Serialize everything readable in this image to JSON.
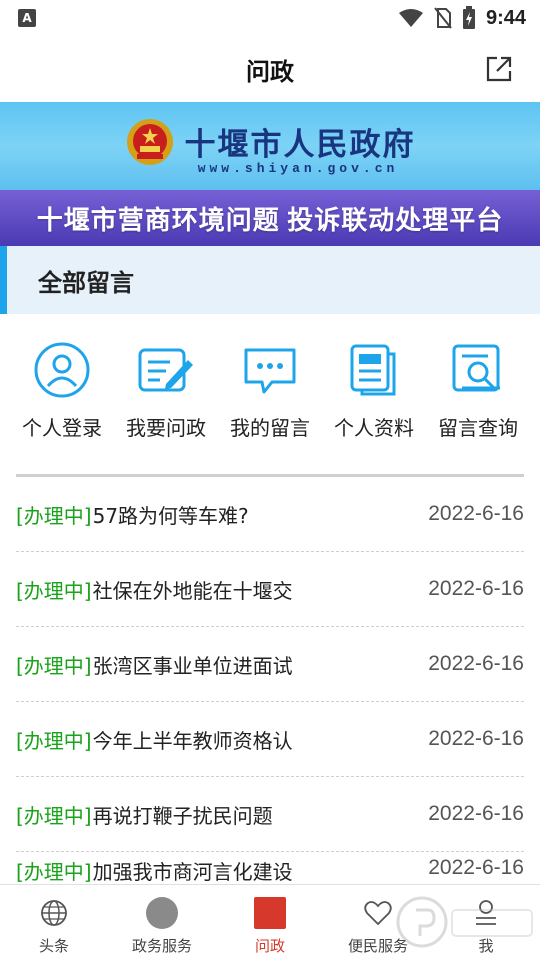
{
  "status_bar": {
    "notification_icon": "A",
    "time": "9:44"
  },
  "header": {
    "title": "问政"
  },
  "banner": {
    "gov_name": "十堰市人民政府",
    "gov_url": "www.shiyan.gov.cn",
    "platform_name": "十堰市营商环境问题 投诉联动处理平台"
  },
  "section": {
    "title": "全部留言"
  },
  "quick_actions": [
    {
      "label": "个人登录",
      "icon": "person-icon"
    },
    {
      "label": "我要问政",
      "icon": "edit-icon"
    },
    {
      "label": "我的留言",
      "icon": "chat-icon"
    },
    {
      "label": "个人资料",
      "icon": "document-icon"
    },
    {
      "label": "留言查询",
      "icon": "search-icon"
    }
  ],
  "messages": [
    {
      "status": "[办理中]",
      "title": "57路为何等车难?",
      "date": "2022-6-16"
    },
    {
      "status": "[办理中]",
      "title": "社保在外地能在十堰交",
      "date": "2022-6-16"
    },
    {
      "status": "[办理中]",
      "title": "张湾区事业单位进面试",
      "date": "2022-6-16"
    },
    {
      "status": "[办理中]",
      "title": "今年上半年教师资格认",
      "date": "2022-6-16"
    },
    {
      "status": "[办理中]",
      "title": "再说打鞭子扰民问题",
      "date": "2022-6-16"
    },
    {
      "status": "[办理中]",
      "title": "加强我市商河言化建设",
      "date": "2022-6-16"
    }
  ],
  "tabs": [
    {
      "label": "头条",
      "icon": "globe-icon"
    },
    {
      "label": "政务服务",
      "icon": "circle-icon"
    },
    {
      "label": "问政",
      "icon": "square-icon"
    },
    {
      "label": "便民服务",
      "icon": "heart-icon"
    },
    {
      "label": "我",
      "icon": "profile-icon"
    }
  ],
  "colors": {
    "accent_blue": "#1ea4ea",
    "status_green": "#1aa31a",
    "active_tab": "#d6392b"
  }
}
